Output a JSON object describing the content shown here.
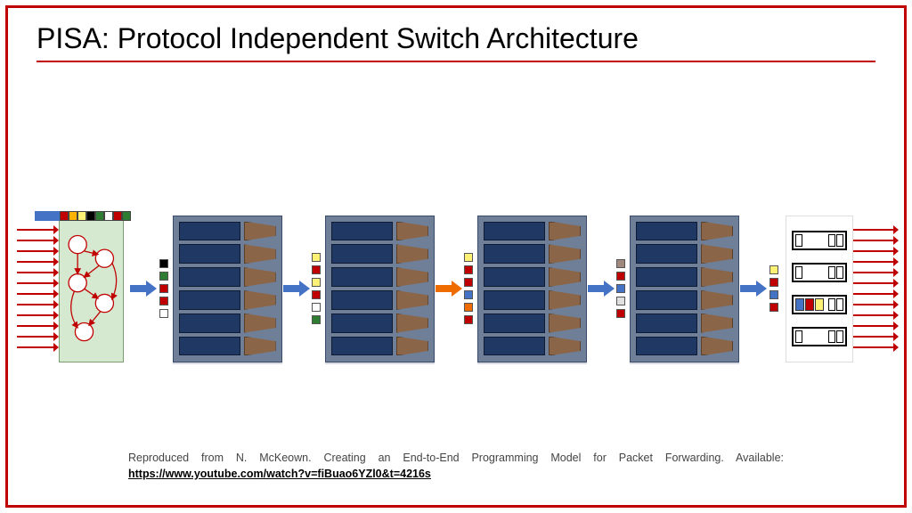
{
  "title": "PISA: Protocol Independent Switch Architecture",
  "citation": {
    "prefix": "Reproduced from N. McKeown. Creating an End-to-End Programming Model for Packet Forwarding. Available: ",
    "link": "https://www.youtube.com/watch?v=fiBuao6YZl0&t=4216s"
  },
  "stage_tags": [
    [
      "#000000",
      "#2e7d32",
      "#c00000",
      "#c00000",
      "#ffffff"
    ],
    [
      "#fff176",
      "#c00000",
      "#fff176",
      "#c00000",
      "#ffffff",
      "#2e7d32"
    ],
    [
      "#fff176",
      "#c00000",
      "#c00000",
      "#4472c4",
      "#ef6c00",
      "#c00000"
    ],
    [
      "#a1887f",
      "#c00000",
      "#4472c4",
      "#e0e0e0",
      "#c00000"
    ]
  ],
  "out_tags": [
    "#fff176",
    "#c00000",
    "#4472c4",
    "#c00000"
  ],
  "parser_tape": [
    "#c00000",
    "#ffb300",
    "#fff176",
    "#000000",
    "#2e7d32",
    "#ffffff",
    "#c00000",
    "#2e7d32"
  ],
  "connector_colors": [
    "#4472c4",
    "#4472c4",
    "#ef6c00",
    "#4472c4",
    "#4472c4"
  ],
  "arrows_in_count": 12,
  "arrows_out_count": 12,
  "match_rows": 6,
  "stages": 4,
  "queues": 4
}
